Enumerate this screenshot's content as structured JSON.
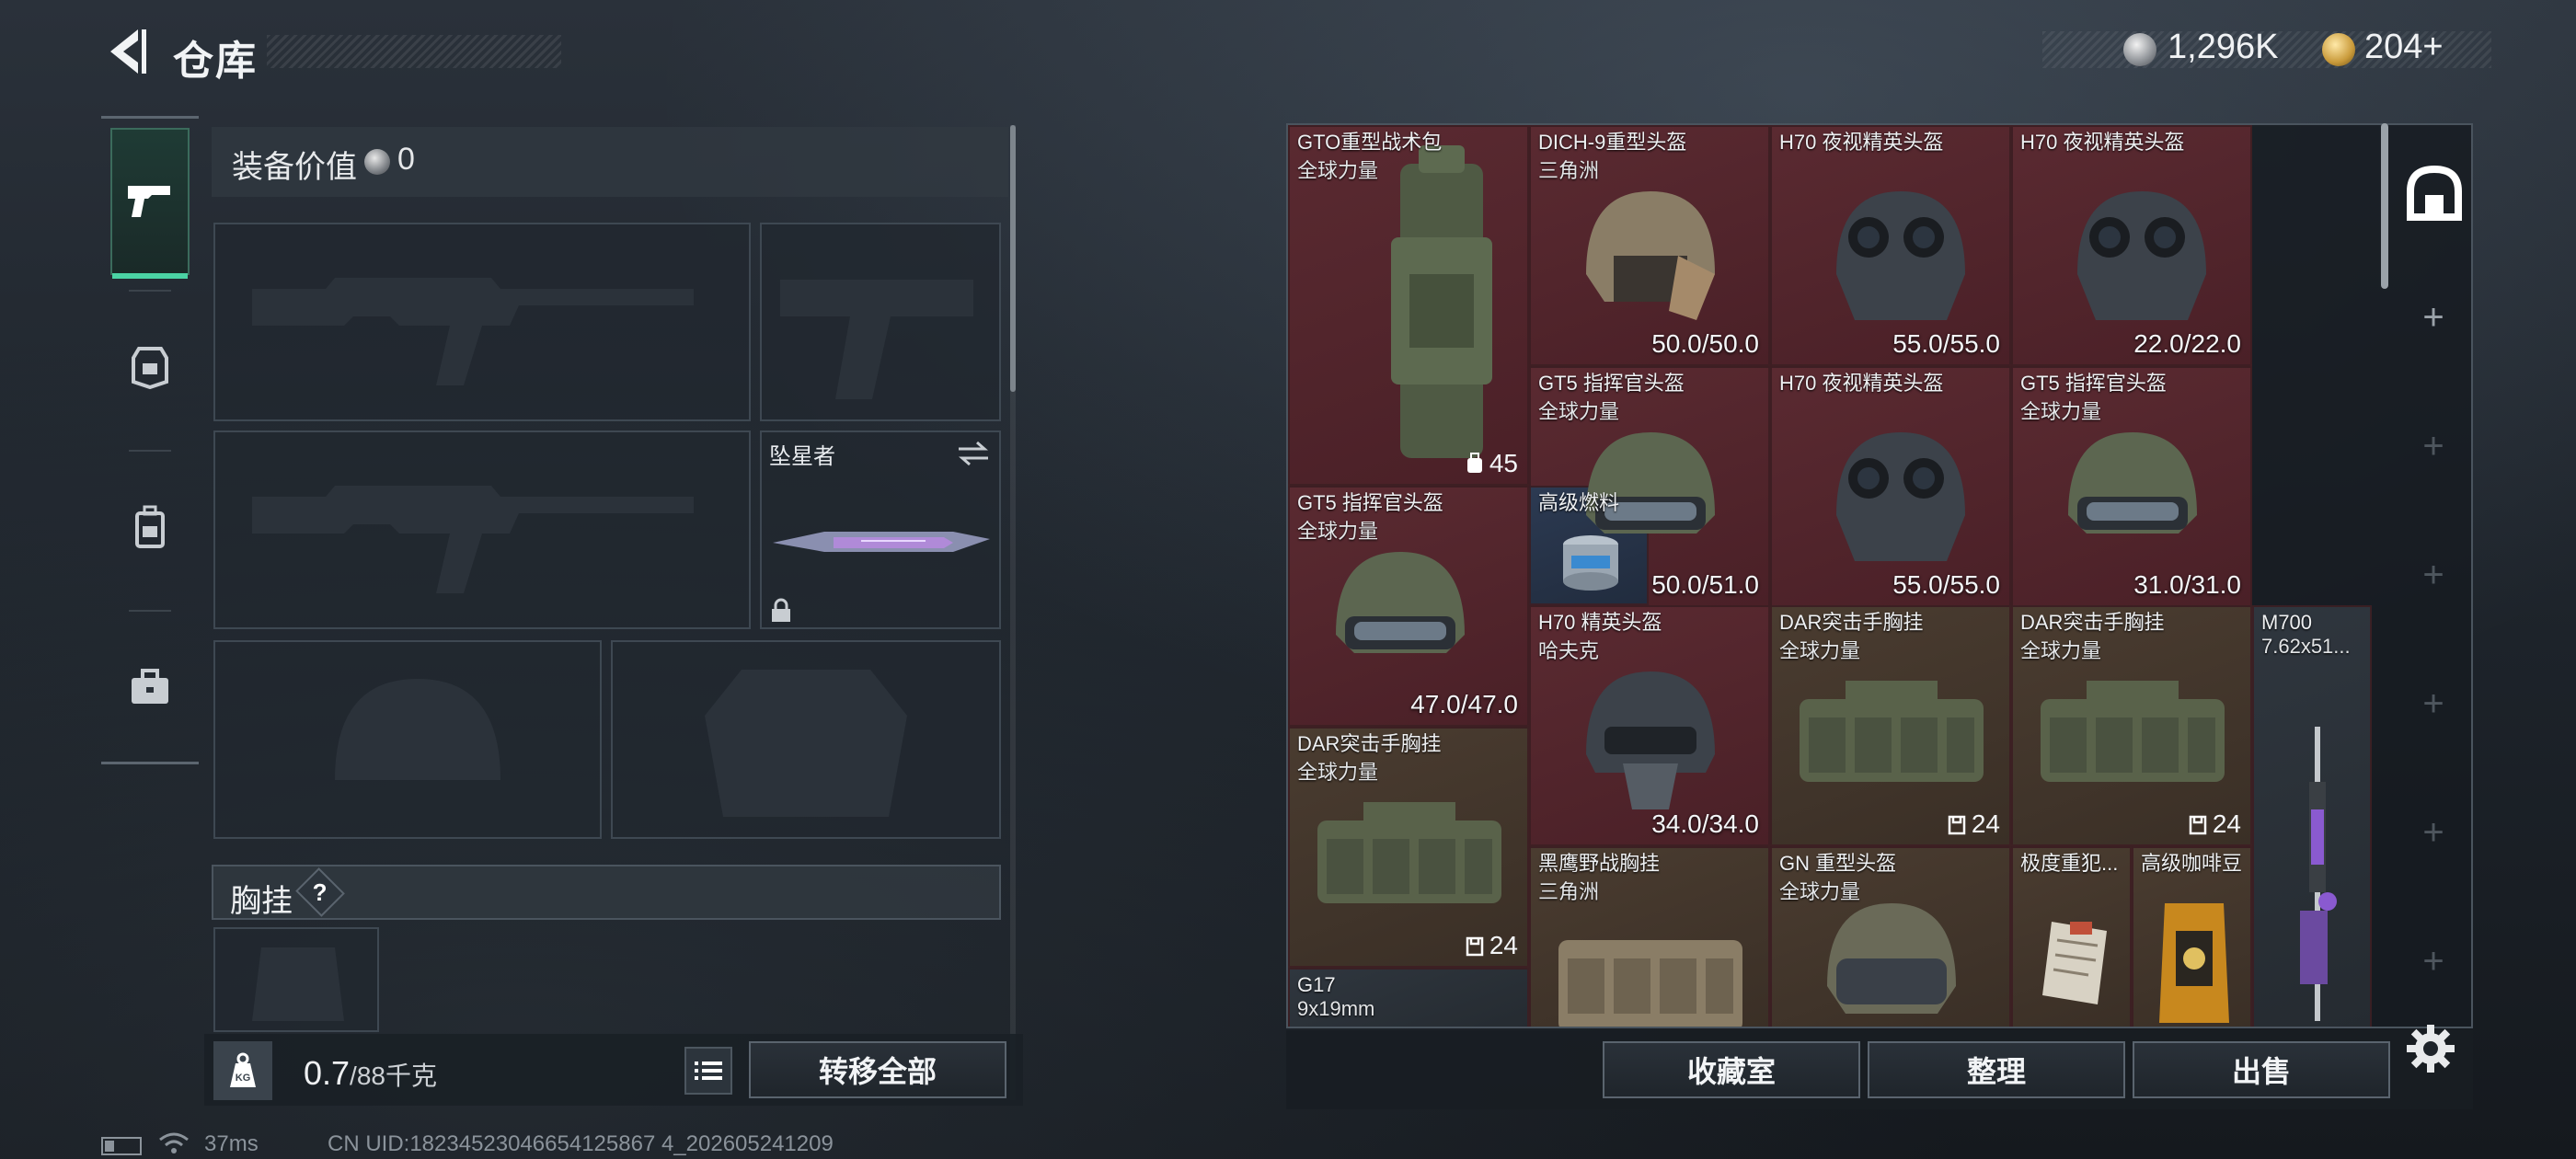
{
  "header": {
    "title": "仓库",
    "currency_silver": "1,296K",
    "currency_gold": "204+"
  },
  "equipment": {
    "value_label": "装备价值",
    "value": "0",
    "melee_label": "坠星者",
    "chest_section": "胸挂",
    "help": "?"
  },
  "weight": {
    "current": "0.7",
    "max": "/88千克"
  },
  "buttons": {
    "transfer_all": "转移全部",
    "collection": "收藏室",
    "sort": "整理",
    "sell": "出售"
  },
  "status": {
    "ping": "37ms",
    "uid": "CN UID:18234523046654125867 4_202605241209"
  },
  "inventory": [
    {
      "name": "GTO重型战术包",
      "sub": "全球力量",
      "cap": "45",
      "tone": "red"
    },
    {
      "name": "DICH-9重型头盔",
      "sub": "三角洲",
      "dur": "50.0/50.0",
      "tone": "red"
    },
    {
      "name": "H70 夜视精英头盔",
      "sub": "",
      "dur": "55.0/55.0",
      "tone": "red"
    },
    {
      "name": "H70 夜视精英头盔",
      "sub": "",
      "dur": "22.0/22.0",
      "tone": "red"
    },
    {
      "name": "GT5 指挥官头盔",
      "sub": "全球力量",
      "dur": "50.0/51.0",
      "tone": "red"
    },
    {
      "name": "H70 夜视精英头盔",
      "sub": "",
      "dur": "55.0/55.0",
      "tone": "red"
    },
    {
      "name": "GT5 指挥官头盔",
      "sub": "全球力量",
      "dur": "31.0/31.0",
      "tone": "red"
    },
    {
      "name": "GT5 指挥官头盔",
      "sub": "全球力量",
      "dur": "47.0/47.0",
      "tone": "red"
    },
    {
      "name": "高级燃料",
      "sub": "",
      "tone": "blue"
    },
    {
      "name": "H70 精英头盔",
      "sub": "哈夫克",
      "dur": "34.0/34.0",
      "tone": "red"
    },
    {
      "name": "DAR突击手胸挂",
      "sub": "全球力量",
      "cap": "24",
      "tone": "tan"
    },
    {
      "name": "DAR突击手胸挂",
      "sub": "全球力量",
      "cap": "24",
      "tone": "tan"
    },
    {
      "name": "M700",
      "sub": "7.62x51...",
      "tone": "grey"
    },
    {
      "name": "DAR突击手胸挂",
      "sub": "全球力量",
      "cap": "24",
      "tone": "tan"
    },
    {
      "name": "黑鹰野战胸挂",
      "sub": "三角洲",
      "tone": "tan"
    },
    {
      "name": "GN 重型头盔",
      "sub": "全球力量",
      "tone": "tan"
    },
    {
      "name": "极度重犯...",
      "sub": "",
      "tone": "tan"
    },
    {
      "name": "高级咖啡豆",
      "sub": "",
      "tone": "tan"
    },
    {
      "name": "G17",
      "sub": "9x19mm",
      "tone": "grey"
    }
  ],
  "icons": {
    "back": "back-arrow-icon",
    "weight": "kg-weight-icon",
    "list": "list-icon",
    "settings": "gear-icon"
  },
  "colors": {
    "active_accent": "#4bd3a4",
    "rarity_red": "#5a2a31",
    "rarity_tan": "#4a3c30",
    "rarity_blue": "#2c3a52"
  }
}
